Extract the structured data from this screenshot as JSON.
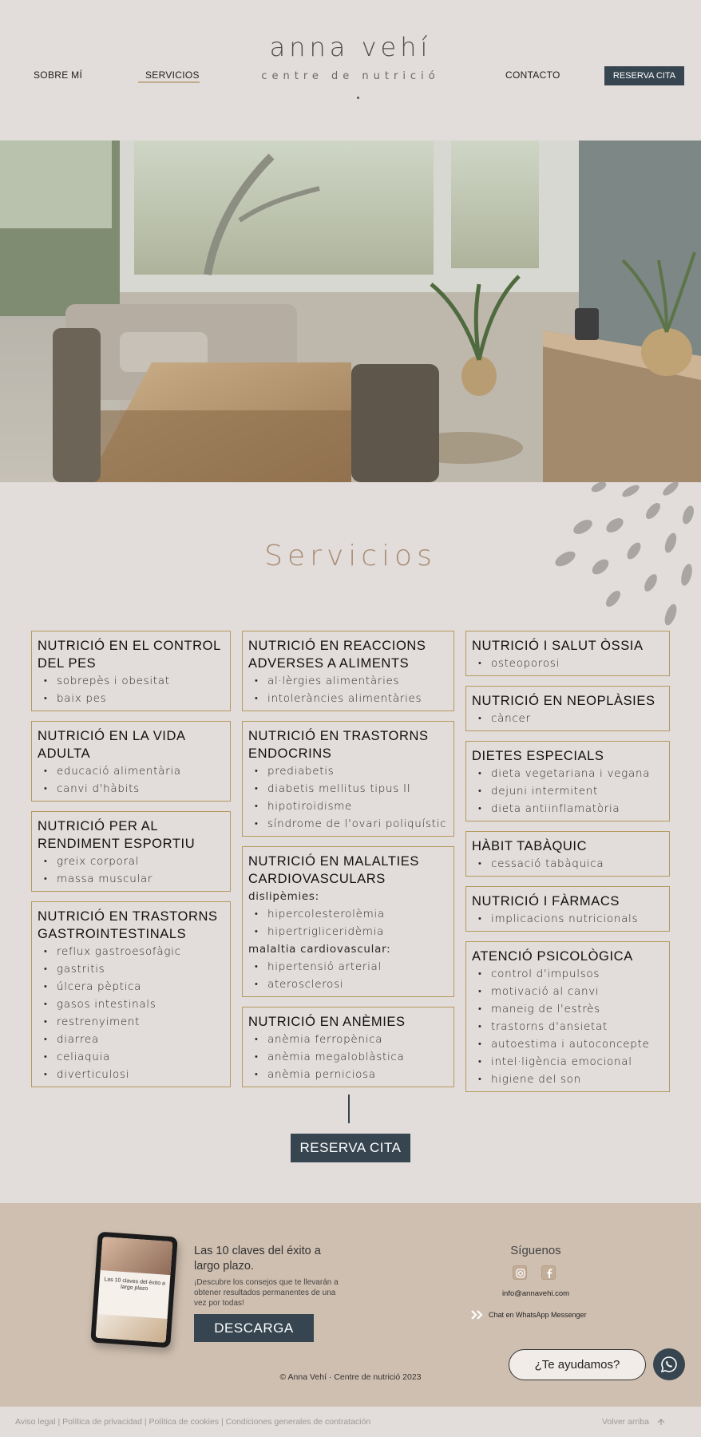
{
  "nav": {
    "sobre": "SOBRE MÍ",
    "servicios": "SERVICIOS",
    "contacto": "CONTACTO",
    "reserva": "RESERVA CITA"
  },
  "logo": {
    "name": "anna vehí",
    "subtitle": "centre de nutrició"
  },
  "section_title": "Servicios",
  "columns": [
    [
      {
        "title": "NUTRICIÓ EN EL CONTROL DEL PES",
        "groups": [
          {
            "label": "",
            "items": [
              "sobrepès i obesitat",
              "baix pes"
            ]
          }
        ]
      },
      {
        "title": "NUTRICIÓ EN LA VIDA ADULTA",
        "groups": [
          {
            "label": "",
            "items": [
              "educació alimentària",
              "canvi d'hàbits"
            ]
          }
        ]
      },
      {
        "title": "NUTRICIÓ PER AL RENDIMENT ESPORTIU",
        "groups": [
          {
            "label": "",
            "items": [
              "greix corporal",
              "massa muscular"
            ]
          }
        ]
      },
      {
        "title": "NUTRICIÓ EN TRASTORNS GASTROINTESTINALS",
        "groups": [
          {
            "label": "",
            "items": [
              "reflux gastroesofàgic",
              "gastritis",
              "úlcera pèptica",
              "gasos intestinals",
              "restrenyiment",
              "diarrea",
              "celiaquia",
              "diverticulosi"
            ]
          }
        ]
      }
    ],
    [
      {
        "title": "NUTRICIÓ EN REACCIONS ADVERSES A ALIMENTS",
        "groups": [
          {
            "label": "",
            "items": [
              "al·lèrgies alimentàries",
              "intoleràncies alimentàries"
            ]
          }
        ]
      },
      {
        "title": "NUTRICIÓ EN TRASTORNS ENDOCRINS",
        "groups": [
          {
            "label": "",
            "items": [
              "prediabetis",
              "diabetis mellitus tipus II",
              "hipotiroïdisme",
              "síndrome de l'ovari poliquístic"
            ]
          }
        ]
      },
      {
        "title": "NUTRICIÓ EN MALALTIES CARDIOVASCULARS",
        "groups": [
          {
            "label": "dislipèmies:",
            "items": [
              "hipercolesterolèmia",
              "hipertrigliceridèmia"
            ]
          },
          {
            "label": "malaltia cardiovascular:",
            "items": [
              "hipertensió arterial",
              "aterosclerosi"
            ]
          }
        ]
      },
      {
        "title": "NUTRICIÓ EN ANÈMIES",
        "groups": [
          {
            "label": "",
            "items": [
              "anèmia ferropènica",
              "anèmia megaloblàstica",
              "anèmia perniciosa"
            ]
          }
        ]
      }
    ],
    [
      {
        "title": "NUTRICIÓ I SALUT ÒSSIA",
        "groups": [
          {
            "label": "",
            "items": [
              "osteoporosi"
            ]
          }
        ]
      },
      {
        "title": "NUTRICIÓ EN NEOPLÀSIES",
        "groups": [
          {
            "label": "",
            "items": [
              "càncer"
            ]
          }
        ]
      },
      {
        "title": "DIETES ESPECIALS",
        "groups": [
          {
            "label": "",
            "items": [
              "dieta vegetariana i vegana",
              "dejuni intermitent",
              "dieta antiinflamatòria"
            ]
          }
        ]
      },
      {
        "title": "HÀBIT TABÀQUIC",
        "groups": [
          {
            "label": "",
            "items": [
              "cessació tabàquica"
            ]
          }
        ]
      },
      {
        "title": "NUTRICIÓ I FÀRMACS",
        "groups": [
          {
            "label": "",
            "items": [
              "implicacions nutricionals"
            ]
          }
        ]
      },
      {
        "title": "ATENCIÓ PSICOLÒGICA",
        "groups": [
          {
            "label": "",
            "items": [
              "control d'impulsos",
              "motivació al canvi",
              "maneig de l'estrès",
              "trastorns d'ansietat",
              "autoestima i autoconcepte",
              "intel·ligència emocional",
              "higiene del son"
            ]
          }
        ]
      }
    ]
  ],
  "cta_reserva": "RESERVA CITA",
  "footer": {
    "tablet_text": "Las 10 claves del éxito a largo plazo",
    "promo_title": "Las 10 claves del éxito a largo plazo.",
    "promo_text": "¡Descubre los consejos que te llevarán a obtener resultados permanentes de una vez por todas!",
    "promo_button": "DESCARGA",
    "siguenos": "Síguenos",
    "email": "info@annavehi.com",
    "whatsapp": "Chat en WhatsApp Messenger",
    "copyright": "© Anna Vehí · Centre de nutrició 2023",
    "help": "¿Te ayudamos?"
  },
  "legal": {
    "aviso": "Aviso legal",
    "privacidad": "Política de privacidad",
    "cookies": "Política de cookies",
    "condiciones": "Condiciones generales de contratación",
    "separator": " | "
  },
  "back_to_top": "Volver arriba",
  "colors": {
    "background": "#e2dcda",
    "accent_dark": "#364550",
    "card_border": "#b59a5f",
    "title_brown": "#a88e74",
    "footer_bg": "#cfbfb0"
  },
  "icons": [
    "instagram-icon",
    "facebook-icon",
    "whatsapp-icon",
    "double-chevron-icon",
    "arrow-up-icon"
  ]
}
